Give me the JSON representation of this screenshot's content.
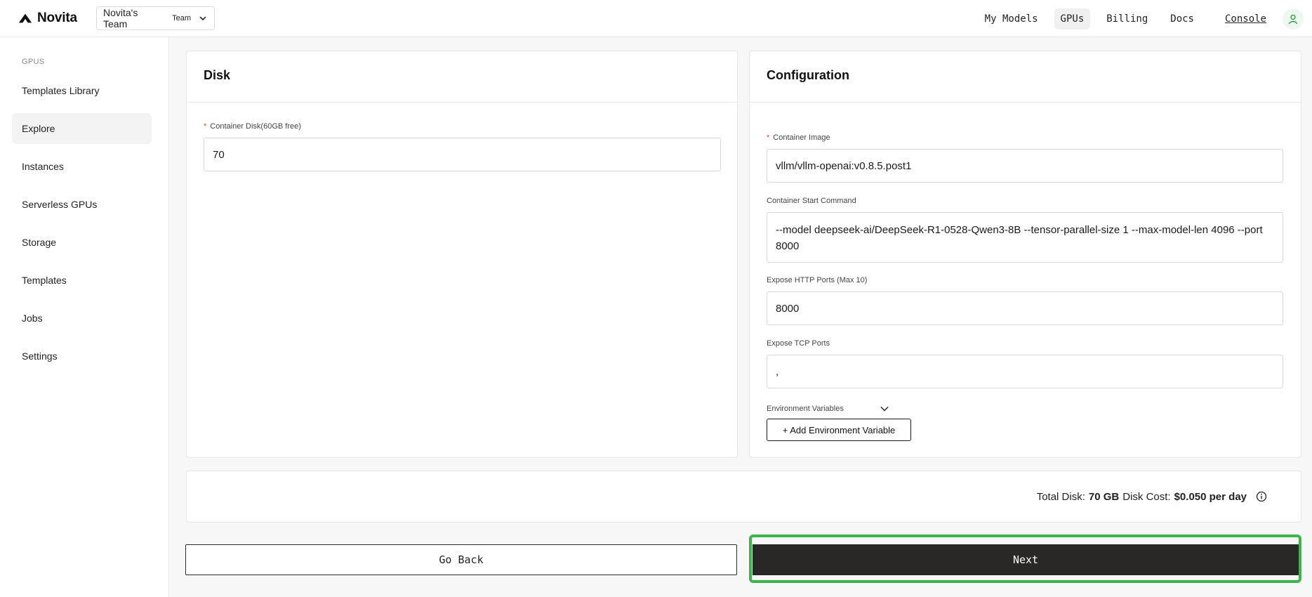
{
  "header": {
    "logo_text": "Novita",
    "team_name": "Novita's Team",
    "team_badge": "Team",
    "nav": [
      "My Models",
      "GPUs",
      "Billing",
      "Docs"
    ],
    "active_nav": "GPUs",
    "console_label": "Console"
  },
  "sidebar": {
    "section": "GPUS",
    "items": [
      {
        "label": "Templates Library"
      },
      {
        "label": "Explore"
      },
      {
        "label": "Instances"
      },
      {
        "label": "Serverless GPUs"
      },
      {
        "label": "Storage"
      },
      {
        "label": "Templates"
      },
      {
        "label": "Jobs"
      },
      {
        "label": "Settings"
      }
    ],
    "active_item": "Explore"
  },
  "disk": {
    "title": "Disk",
    "container_disk_label": "Container Disk(60GB free)",
    "container_disk_value": "70"
  },
  "configuration": {
    "title": "Configuration",
    "container_image_label": "Container Image",
    "container_image_value": "vllm/vllm-openai:v0.8.5.post1",
    "start_command_label": "Container Start Command",
    "start_command_value": "--model deepseek-ai/DeepSeek-R1-0528-Qwen3-8B --tensor-parallel-size 1 --max-model-len 4096 --port 8000",
    "http_ports_label": "Expose HTTP Ports (Max 10)",
    "http_ports_value": "8000",
    "tcp_ports_label": "Expose TCP Ports",
    "tcp_ports_value": ",",
    "env_label": "Environment Variables",
    "add_env_label": "+ Add Environment Variable"
  },
  "summary": {
    "total_disk_label": "Total Disk:",
    "total_disk_value": "70 GB",
    "disk_cost_label": "Disk Cost:",
    "disk_cost_value": "$0.050 per day"
  },
  "actions": {
    "back_label": "Go Back",
    "next_label": "Next"
  },
  "colors": {
    "accent_green": "#3ab54a",
    "required_red": "#e23b3b",
    "next_bg": "#2a2826"
  }
}
